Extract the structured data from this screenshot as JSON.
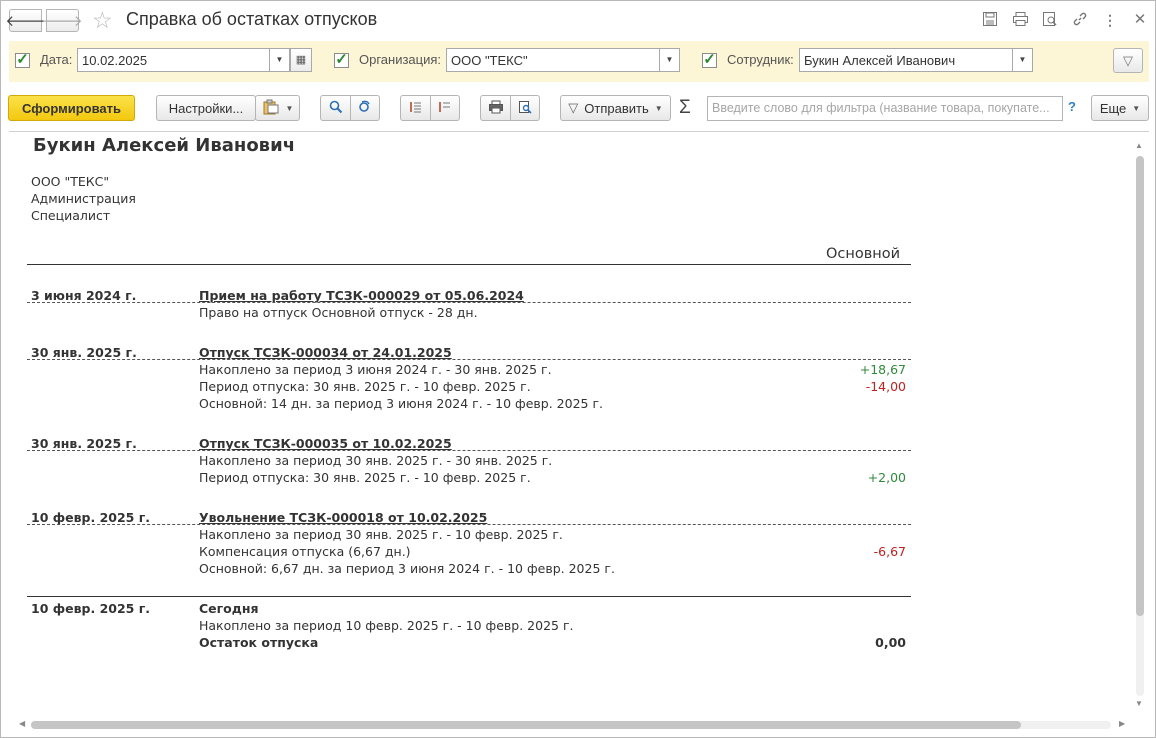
{
  "window": {
    "title": "Справка об остатках отпусков"
  },
  "params": {
    "date_label": "Дата:",
    "date_value": "10.02.2025",
    "org_label": "Организация:",
    "org_value": "ООО \"ТЕКС\"",
    "emp_label": "Сотрудник:",
    "emp_value": "Букин Алексей Иванович"
  },
  "toolbar": {
    "generate_label": "Сформировать",
    "settings_label": "Настройки...",
    "send_label": "Отправить",
    "search_placeholder": "Введите слово для фильтра (название товара, покупате...",
    "help_label": "?",
    "more_label": "Еще"
  },
  "report": {
    "employee": "Букин Алексей Иванович",
    "org": "ООО \"ТЕКС\"",
    "department": "Администрация",
    "position": "Специалист",
    "column_header": "Основной",
    "events": [
      {
        "date": "3 июня 2024 г.",
        "doc": "Прием на работу ТСЗК-000029 от 05.06.2024",
        "lines": [
          {
            "text": "Право на отпуск Основной отпуск - 28 дн.",
            "value": ""
          }
        ]
      },
      {
        "date": "30 янв. 2025 г.",
        "doc": "Отпуск ТСЗК-000034 от 24.01.2025",
        "lines": [
          {
            "text": "Накоплено за период 3 июня 2024 г. - 30 янв. 2025 г.",
            "value": "+18,67"
          },
          {
            "text": "Период отпуска: 30 янв. 2025 г. - 10 февр. 2025 г.",
            "value": "-14,00"
          },
          {
            "text": "Основной: 14 дн. за период 3 июня 2024 г. - 10 февр. 2025 г.",
            "value": ""
          }
        ]
      },
      {
        "date": "30 янв. 2025 г.",
        "doc": "Отпуск ТСЗК-000035 от 10.02.2025",
        "lines": [
          {
            "text": "Накоплено за период 30 янв. 2025 г. - 30 янв. 2025 г.",
            "value": ""
          },
          {
            "text": "Период отпуска: 30 янв. 2025 г. - 10 февр. 2025 г.",
            "value": "+2,00"
          }
        ]
      },
      {
        "date": "10 февр. 2025 г.",
        "doc": "Увольнение ТСЗК-000018 от 10.02.2025",
        "lines": [
          {
            "text": "Накоплено за период 30 янв. 2025 г. - 10 февр. 2025 г.",
            "value": ""
          },
          {
            "text": "Компенсация отпуска (6,67 дн.)",
            "value": "-6,67"
          },
          {
            "text": "Основной: 6,67 дн. за период 3 июня 2024 г. - 10 февр. 2025 г.",
            "value": ""
          }
        ]
      }
    ],
    "today": {
      "date": "10 февр. 2025 г.",
      "label": "Сегодня",
      "accrued": "Накоплено за период 10 февр. 2025 г. - 10 февр. 2025 г.",
      "balance_label": "Остаток отпуска",
      "balance_value": "0,00"
    }
  },
  "colors": {
    "positive": "#2e8b3a",
    "negative": "#c52020",
    "accent": "#f3c80f",
    "params_bg": "#fcf6d6"
  }
}
